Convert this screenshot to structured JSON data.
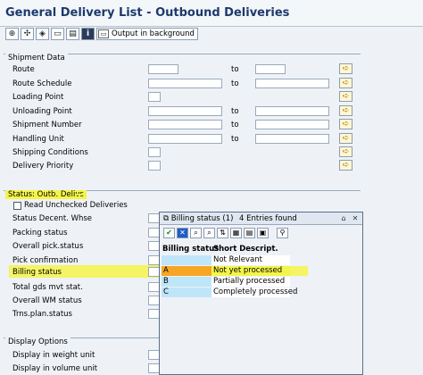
{
  "window": {
    "title": "General Delivery List - Outbound Deliveries"
  },
  "toolbar": {
    "output_bg_label": "Output in background",
    "icon_execute": "execute-icon",
    "icon_variant": "variant-icon",
    "icon_selection_options": "selection-options-icon",
    "icon_get_variant": "get-variant-icon",
    "icon_info": "info-icon"
  },
  "shipment_data": {
    "group_label": "Shipment Data",
    "to_label": "to",
    "rows": [
      {
        "label": "Route",
        "range": true
      },
      {
        "label": "Route Schedule",
        "range": true
      },
      {
        "label": "Loading Point",
        "range": false
      },
      {
        "label": "Unloading Point",
        "range": true
      },
      {
        "label": "Shipment Number",
        "range": true
      },
      {
        "label": "Handling Unit",
        "range": true
      },
      {
        "label": "Shipping Conditions",
        "range": false
      },
      {
        "label": "Delivery Priority",
        "range": false
      }
    ]
  },
  "status": {
    "group_label": "Status: Outb. Delivs",
    "read_unchecked": "Read Unchecked Deliveries",
    "rows": [
      {
        "label": "Status Decent. Whse"
      },
      {
        "label": "Packing status"
      },
      {
        "label": "Overall pick.status"
      },
      {
        "label": "Pick confirmation"
      },
      {
        "label": "Billing status"
      },
      {
        "label": "Total gds mvt stat."
      },
      {
        "label": "Overall WM status"
      },
      {
        "label": "Trns.plan.status"
      }
    ]
  },
  "display_options": {
    "group_label": "Display Options",
    "rows": [
      {
        "label": "Display in weight unit"
      },
      {
        "label": "Display in volume unit"
      }
    ]
  },
  "popup": {
    "title": "Billing status (1)",
    "entries_found": "4 Entries found",
    "columns": [
      "Billing status",
      "Short Descript."
    ],
    "rows": [
      {
        "key": "",
        "desc": "Not Relevant"
      },
      {
        "key": "A",
        "desc": "Not yet processed"
      },
      {
        "key": "B",
        "desc": "Partially processed"
      },
      {
        "key": "C",
        "desc": "Completely processed"
      }
    ],
    "selected_index": 1
  },
  "colors": {
    "highlight": "#f4f54a",
    "selected_key": "#f6a623",
    "key_cell": "#bfe6f8",
    "title_text": "#1c3a6b"
  }
}
